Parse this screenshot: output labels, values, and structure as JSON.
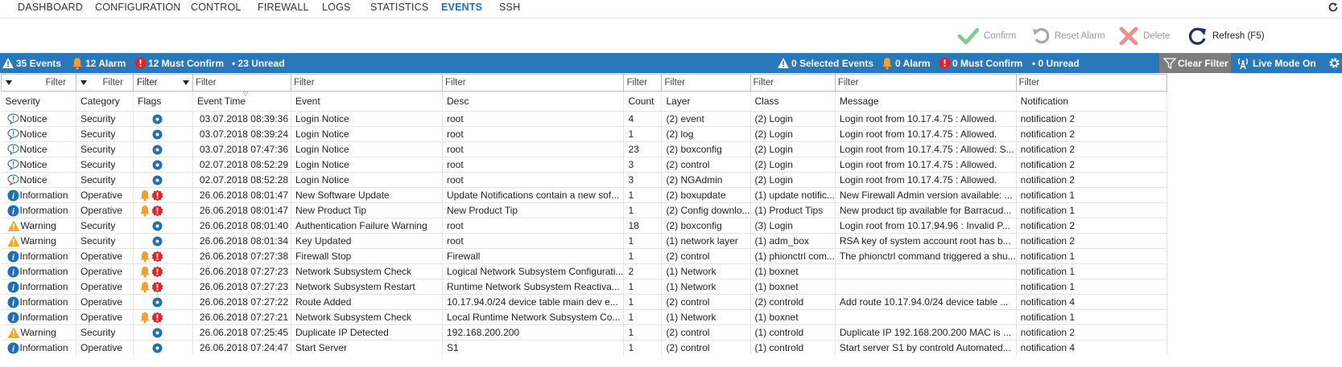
{
  "nav": {
    "tabs": [
      "DASHBOARD",
      "CONFIGURATION",
      "CONTROL",
      "FIREWALL",
      "LOGS",
      "STATISTICS",
      "EVENTS",
      "SSH"
    ],
    "active": "EVENTS"
  },
  "actions": {
    "confirm": "Confirm",
    "reset_alarm": "Reset Alarm",
    "delete": "Delete",
    "refresh": "Refresh (F5)"
  },
  "statusbar": {
    "events": "35 Events",
    "alarm": "12 Alarm",
    "must_confirm": "12 Must Confirm",
    "unread": "• 23 Unread",
    "selected_events": "0 Selected Events",
    "selected_alarm": "0 Alarm",
    "selected_must_confirm": "0 Must Confirm",
    "selected_unread": "• 0 Unread",
    "clear_filter": "Clear Filter",
    "live_mode": "Live Mode On"
  },
  "filters": {
    "placeholder": "Filter"
  },
  "columns": [
    "Severity",
    "Category",
    "Flags",
    "Event Time",
    "Event",
    "Desc",
    "Count",
    "Layer",
    "Class",
    "Message",
    "Notification"
  ],
  "colors": {
    "accent": "#2a77b9",
    "info": "#1f6fb6",
    "warning": "#f5a623",
    "alarm": "#f0a030",
    "mustconfirm": "#d9262b",
    "confirm_green": "#7ecb8a",
    "delete_red": "#ef8e8e"
  },
  "rows": [
    {
      "severity": "Notice",
      "category": "Security",
      "flags": [
        "dot"
      ],
      "time": "03.07.2018 08:39:36",
      "event": "Login Notice",
      "desc": "root",
      "count": "4",
      "layer": "(2) event",
      "class": "(2) Login",
      "message": "Login root from 10.17.4.75 : Allowed.",
      "notification": "notification 2"
    },
    {
      "severity": "Notice",
      "category": "Security",
      "flags": [
        "dot"
      ],
      "time": "03.07.2018 08:39:24",
      "event": "Login Notice",
      "desc": "root",
      "count": "1",
      "layer": "(2) log",
      "class": "(2) Login",
      "message": "Login root from 10.17.4.75 : Allowed.",
      "notification": "notification 2"
    },
    {
      "severity": "Notice",
      "category": "Security",
      "flags": [
        "dot"
      ],
      "time": "03.07.2018 07:47:36",
      "event": "Login Notice",
      "desc": "root",
      "count": "23",
      "layer": "(2) boxconfig",
      "class": "(2) Login",
      "message": "Login root from 10.17.4.75 : Allowed: S...",
      "notification": "notification 2"
    },
    {
      "severity": "Notice",
      "category": "Security",
      "flags": [
        "dot"
      ],
      "time": "02.07.2018 08:52:29",
      "event": "Login Notice",
      "desc": "root",
      "count": "3",
      "layer": "(2) control",
      "class": "(2) Login",
      "message": "Login root from 10.17.4.75 : Allowed.",
      "notification": "notification 2"
    },
    {
      "severity": "Notice",
      "category": "Security",
      "flags": [
        "dot"
      ],
      "time": "02.07.2018 08:52:28",
      "event": "Login Notice",
      "desc": "root",
      "count": "3",
      "layer": "(2) NGAdmin",
      "class": "(2) Login",
      "message": "Login root from 10.17.4.75 : Allowed.",
      "notification": "notification 2"
    },
    {
      "severity": "Information",
      "category": "Operative",
      "flags": [
        "bell",
        "mc"
      ],
      "time": "26.06.2018 08:01:47",
      "event": "New Software Update",
      "desc": "Update Notifications contain a new sof...",
      "count": "1",
      "layer": "(2) boxupdate",
      "class": "(1) update notific...",
      "message": "New Firewall Admin version available: ...",
      "notification": "notification 1"
    },
    {
      "severity": "Information",
      "category": "Operative",
      "flags": [
        "bell",
        "mc"
      ],
      "time": "26.06.2018 08:01:47",
      "event": "New Product Tip",
      "desc": "New Product Tip",
      "count": "1",
      "layer": "(2) Config downlo...",
      "class": "(1) Product Tips",
      "message": "New product tip available for Barracud...",
      "notification": "notification 1"
    },
    {
      "severity": "Warning",
      "category": "Security",
      "flags": [
        "dot"
      ],
      "time": "26.06.2018 08:01:40",
      "event": "Authentication Failure Warning",
      "desc": "root",
      "count": "18",
      "layer": "(2) boxconfig",
      "class": "(3) Login",
      "message": "Login root from 10.17.94.96 : Invalid P...",
      "notification": "notification 2"
    },
    {
      "severity": "Warning",
      "category": "Security",
      "flags": [
        "dot"
      ],
      "time": "26.06.2018 08:01:34",
      "event": "Key Updated",
      "desc": "root",
      "count": "1",
      "layer": "(1) network layer",
      "class": "(1) adm_box",
      "message": "RSA key of system account root has b...",
      "notification": "notification 2"
    },
    {
      "severity": "Information",
      "category": "Operative",
      "flags": [
        "bell",
        "mc"
      ],
      "time": "26.06.2018 07:27:38",
      "event": "Firewall Stop",
      "desc": "Firewall",
      "count": "1",
      "layer": "(2) control",
      "class": "(1) phionctrl com...",
      "message": "The phionctrl command triggered a shu...",
      "notification": "notification 1"
    },
    {
      "severity": "Information",
      "category": "Operative",
      "flags": [
        "bell",
        "mc"
      ],
      "time": "26.06.2018 07:27:23",
      "event": "Network Subsystem Check",
      "desc": "Logical Network Subsystem Configurati...",
      "count": "2",
      "layer": "(1) Network",
      "class": "(1) boxnet",
      "message": "",
      "notification": "notification 1"
    },
    {
      "severity": "Information",
      "category": "Operative",
      "flags": [
        "bell",
        "mc"
      ],
      "time": "26.06.2018 07:27:23",
      "event": "Network Subsystem Restart",
      "desc": "Runtime Network Subsystem Reactiva...",
      "count": "1",
      "layer": "(1) Network",
      "class": "(1) boxnet",
      "message": "",
      "notification": "notification 1"
    },
    {
      "severity": "Information",
      "category": "Operative",
      "flags": [
        "dot"
      ],
      "time": "26.06.2018 07:27:22",
      "event": "Route Added",
      "desc": "10.17.94.0/24 device table main dev e...",
      "count": "1",
      "layer": "(2) control",
      "class": "(2) controld",
      "message": "Add route 10.17.94.0/24 device table ...",
      "notification": "notification 4"
    },
    {
      "severity": "Information",
      "category": "Operative",
      "flags": [
        "bell",
        "mc"
      ],
      "time": "26.06.2018 07:27:21",
      "event": "Network Subsystem Check",
      "desc": "Local Runtime Network Subsystem Co...",
      "count": "1",
      "layer": "(1) Network",
      "class": "(1) boxnet",
      "message": "",
      "notification": "notification 1"
    },
    {
      "severity": "Warning",
      "category": "Security",
      "flags": [
        "dot"
      ],
      "time": "26.06.2018 07:25:45",
      "event": "Duplicate IP Detected",
      "desc": "192.168.200.200",
      "count": "1",
      "layer": "(2) control",
      "class": "(1) controld",
      "message": "Duplicate IP 192.168.200.200 MAC is ...",
      "notification": "notification 2"
    },
    {
      "severity": "Information",
      "category": "Operative",
      "flags": [
        "dot"
      ],
      "time": "26.06.2018 07:24:47",
      "event": "Start Server",
      "desc": "S1",
      "count": "1",
      "layer": "(2) control",
      "class": "(1) controld",
      "message": "Start server S1 by controld  Automated...",
      "notification": "notification 4"
    }
  ]
}
